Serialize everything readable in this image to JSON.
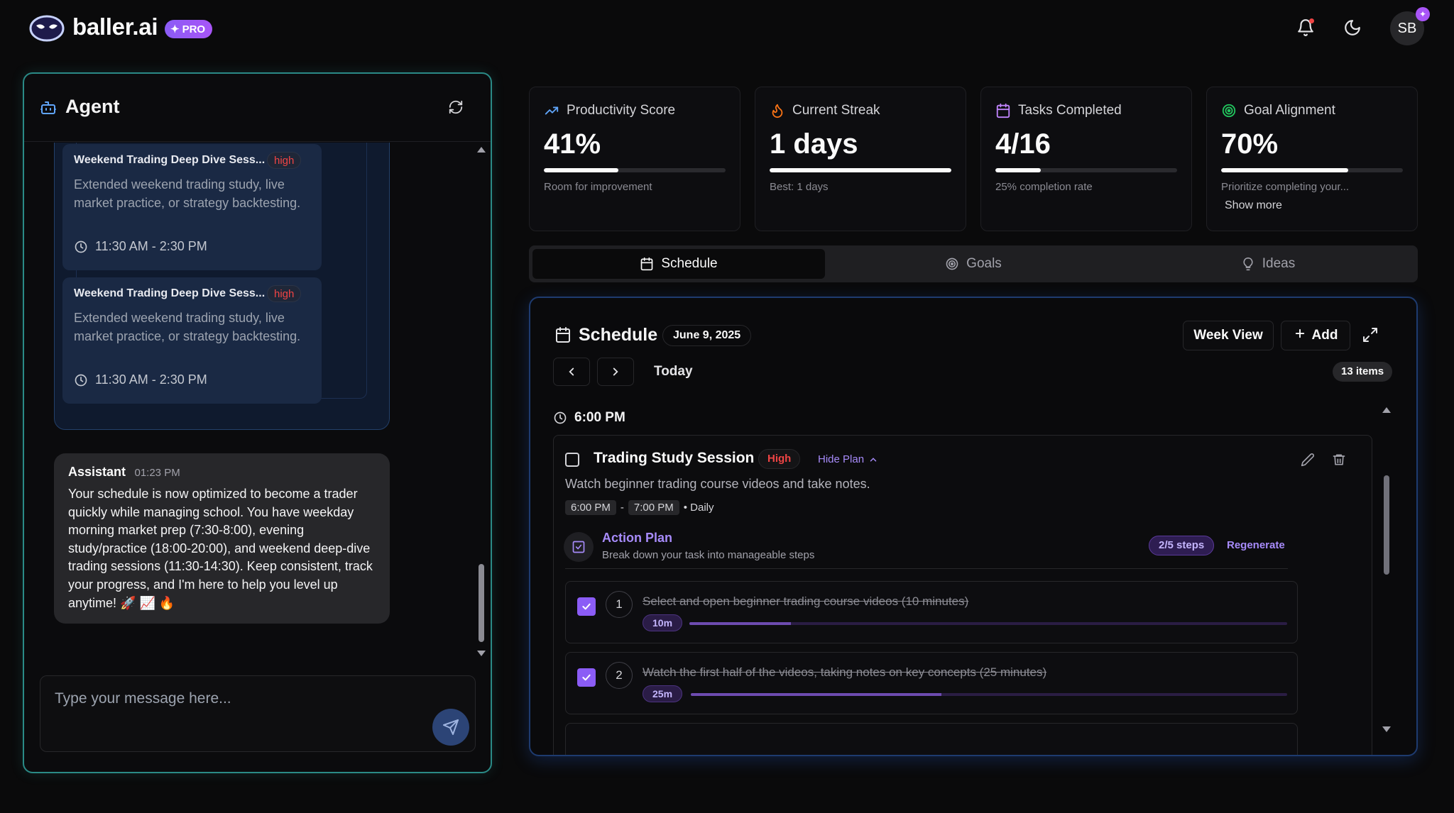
{
  "header": {
    "brand": "baller.ai",
    "pro_badge": "PRO",
    "avatar_initials": "SB"
  },
  "agent": {
    "title": "Agent",
    "task_cards": [
      {
        "title": "Weekend Trading Deep Dive Sess...",
        "priority": "high",
        "description": "Extended weekend trading study, live market practice, or strategy backtesting.",
        "time": "11:30 AM - 2:30 PM"
      },
      {
        "title": "Weekend Trading Deep Dive Sess...",
        "priority": "high",
        "description": "Extended weekend trading study, live market practice, or strategy backtesting.",
        "time": "11:30 AM - 2:30 PM"
      }
    ],
    "assistant": {
      "name": "Assistant",
      "time": "01:23 PM",
      "message": "Your schedule is now optimized to become a trader quickly while managing school. You have weekday morning market prep (7:30-8:00), evening study/practice (18:00-20:00), and weekend deep-dive trading sessions (11:30-14:30). Keep consistent, track your progress, and I'm here to help you level up anytime! 🚀 📈 🔥"
    },
    "input_placeholder": "Type your message here..."
  },
  "stats": [
    {
      "label": "Productivity Score",
      "value": "41%",
      "progress": 0.41,
      "sub": "Room for improvement",
      "icon": "trend-up-icon",
      "color": "#60a5fa"
    },
    {
      "label": "Current Streak",
      "value": "1 days",
      "progress": 1.0,
      "sub": "Best: 1 days",
      "icon": "flame-icon",
      "color": "#f97316"
    },
    {
      "label": "Tasks Completed",
      "value": "4/16",
      "progress": 0.25,
      "sub": "25% completion rate",
      "icon": "calendar-icon",
      "color": "#c084fc"
    },
    {
      "label": "Goal Alignment",
      "value": "70%",
      "progress": 0.7,
      "sub": "Prioritize completing your...",
      "more": "Show more",
      "icon": "target-icon",
      "color": "#22c55e"
    }
  ],
  "tabs": [
    {
      "label": "Schedule",
      "active": true
    },
    {
      "label": "Goals",
      "active": false
    },
    {
      "label": "Ideas",
      "active": false
    }
  ],
  "schedule": {
    "title": "Schedule",
    "date": "June 9, 2025",
    "week_view": "Week View",
    "add": "Add",
    "today": "Today",
    "items_count": "13 items",
    "time_slot": "6:00 PM",
    "task": {
      "title": "Trading Study Session",
      "priority": "High",
      "hide_plan": "Hide Plan",
      "description": "Watch beginner trading course videos and take notes.",
      "start": "6:00 PM",
      "end": "7:00 PM",
      "separator": "-",
      "recurrence": "• Daily",
      "action_plan": {
        "title": "Action Plan",
        "subtitle": "Break down your task into manageable steps",
        "steps_badge": "2/5 steps",
        "regenerate": "Regenerate",
        "steps": [
          {
            "num": "1",
            "text": "Select and open beginner trading course videos (10 minutes)",
            "duration": "10m",
            "progress": 0.17,
            "done": true
          },
          {
            "num": "2",
            "text": "Watch the first half of the videos, taking notes on key concepts (25 minutes)",
            "duration": "25m",
            "progress": 0.42,
            "done": true
          }
        ]
      }
    }
  }
}
